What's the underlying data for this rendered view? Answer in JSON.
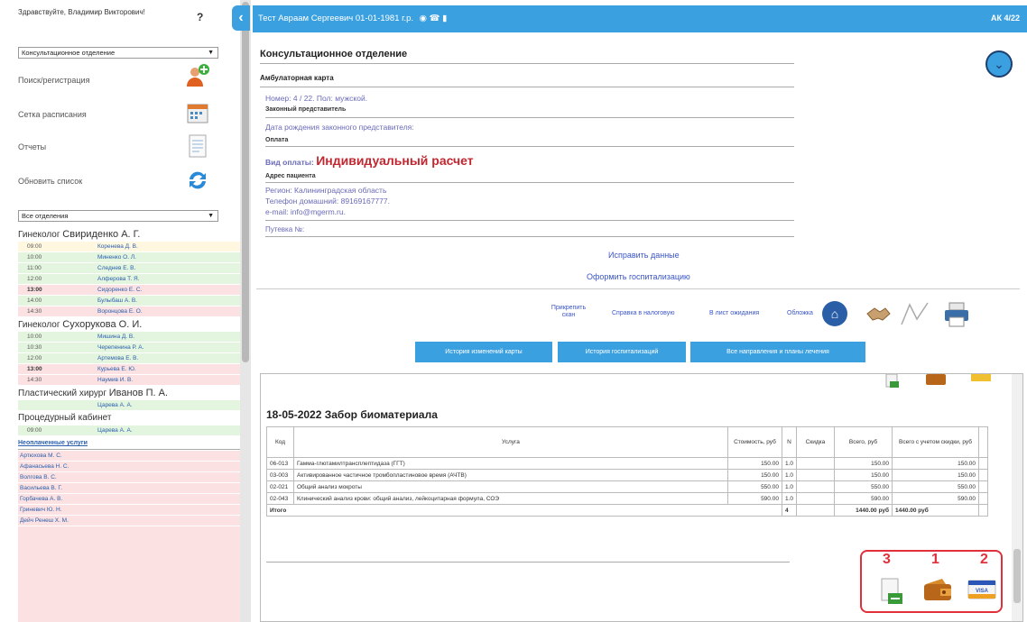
{
  "sidebar": {
    "greeting": "Здравствуйте, Владимир Викторович!",
    "help_label": "?",
    "department_select": "Консультационное отделение",
    "menu": [
      {
        "label": "Поиск/регистрация",
        "icon": "user-add-icon"
      },
      {
        "label": "Сетка расписания",
        "icon": "calendar-icon"
      },
      {
        "label": "Отчеты",
        "icon": "document-icon"
      },
      {
        "label": "Обновить список",
        "icon": "refresh-icon"
      }
    ],
    "filter_select": "Все отделения",
    "doctors": [
      {
        "title": "Гинеколог",
        "name": "Свириденко А. Г.",
        "slots": [
          {
            "time": "09:00",
            "patient": "Коренева Д. В.",
            "color": "yellow"
          },
          {
            "time": "10:00",
            "patient": "Миненко О. Л.",
            "color": "green"
          },
          {
            "time": "11:00",
            "patient": "Следнев Е. В.",
            "color": "green"
          },
          {
            "time": "12:00",
            "patient": "Алферова Т. Я.",
            "color": "green"
          },
          {
            "time": "13:00",
            "patient": "Сидоренко Е. С.",
            "color": "pink"
          },
          {
            "time": "14:00",
            "patient": "Булыбаш А. В.",
            "color": "green"
          },
          {
            "time": "14:30",
            "patient": "Воронцова Е. О.",
            "color": "pink"
          }
        ]
      },
      {
        "title": "Гинеколог",
        "name": "Сухорукова О. И.",
        "slots": [
          {
            "time": "10:00",
            "patient": "Мишина Д. В.",
            "color": "green"
          },
          {
            "time": "10:30",
            "patient": "Черепенина Р. А.",
            "color": "green"
          },
          {
            "time": "12:00",
            "patient": "Артемова Е. В.",
            "color": "green"
          },
          {
            "time": "13:00",
            "patient": "Курьева Е. Ю.",
            "color": "pink"
          },
          {
            "time": "14:30",
            "patient": "Наумив И. В.",
            "color": "pink"
          }
        ]
      },
      {
        "title": "Пластический хирург",
        "name": "Иванов П. А.",
        "slots": [
          {
            "time": "",
            "patient": "Царева А. А.",
            "color": "green"
          }
        ]
      },
      {
        "title": "Процедурный кабинет",
        "name": "",
        "slots": [
          {
            "time": "09:00",
            "patient": "Царева А. А.",
            "color": "green"
          }
        ]
      }
    ],
    "unpaid_title": "Неоплаченные услуги",
    "unpaid": [
      "Артюхова М. С.",
      "Афанасьева Н. С.",
      "Волгова В. С.",
      "Васильева В. Г.",
      "Горбачева А. В.",
      "Гриневич Ю. Н.",
      "Дейч Ренеш Х. М."
    ]
  },
  "topbar": {
    "patient": "Тест Авраам Сергеевич 01-01-1981 г.р.",
    "code": "АК 4/22"
  },
  "card": {
    "department": "Консультационное отделение",
    "card_label": "Амбулаторная карта",
    "number_line": "Номер: 4 / 22. Пол: мужской.",
    "legal_rep_label": "Законный представитель",
    "legal_rep_dob": "Дата рождения законного представителя:",
    "payment_label": "Оплата",
    "payment_prefix": "Вид оплаты:",
    "payment_type": "Индивидуальный расчет",
    "address_label": "Адрес пациента",
    "region": "Регион: Калининградская область",
    "phone": "Телефон домашний: 89169167777.",
    "email": "e-mail: info@mgerm.ru.",
    "voucher": "Путевка №:",
    "edit_link": "Исправить данные",
    "hosp_link": "Оформить госпитализацию",
    "actions": [
      "Прикрепить скан",
      "Справка в налоговую",
      "В лист ожидания",
      "Обложка"
    ],
    "tabs": [
      "История изменений карты",
      "История госпитализаций",
      "Все направления и планы лечения"
    ]
  },
  "document": {
    "title": "18-05-2022 Забор биоматериала",
    "headers": [
      "Код",
      "Услуга",
      "Стоимость, руб",
      "N",
      "Скидка",
      "Всего, руб",
      "Всего с учетом скидки, руб"
    ],
    "rows": [
      [
        "06-013",
        "Гамма-глютамилтрансплептидаза (ГГТ)",
        "150.00",
        "1.0",
        "",
        "150.00",
        "150.00"
      ],
      [
        "03-003",
        "Активированное частичное тромбопластиновое время (АЧТВ)",
        "150.00",
        "1.0",
        "",
        "150.00",
        "150.00"
      ],
      [
        "02-021",
        "Общий анализ мокроты",
        "550.00",
        "1.0",
        "",
        "550.00",
        "550.00"
      ],
      [
        "02-043",
        "Клинический анализ крови: общий анализ, лейкоцитарная формула, СОЭ",
        "590.00",
        "1.0",
        "",
        "590.00",
        "590.00"
      ]
    ],
    "total_label": "Итого",
    "total_n": "4",
    "total_sum": "1440.00 руб",
    "total_disc": "1440.00 руб",
    "callouts": [
      "3",
      "1",
      "2"
    ]
  }
}
